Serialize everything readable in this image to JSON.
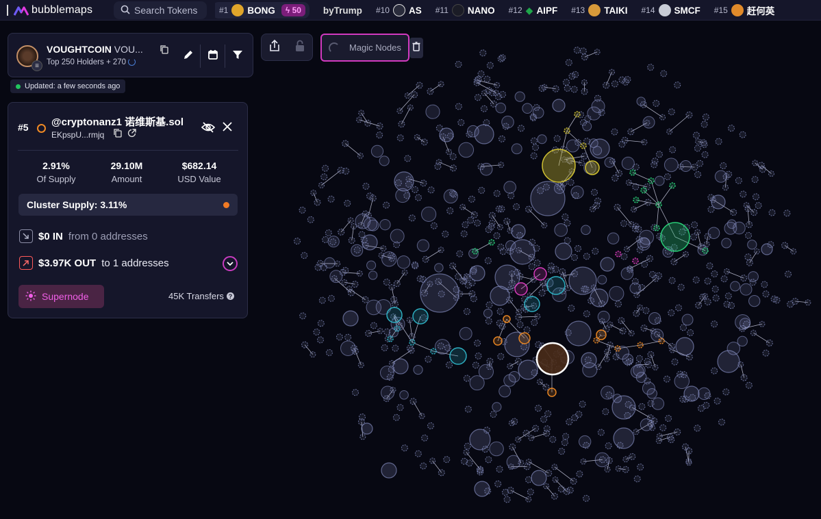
{
  "app": {
    "name": "bubblemaps"
  },
  "search": {
    "placeholder": "Search Tokens"
  },
  "ticker": [
    {
      "rank": "#1",
      "symbol": "BONG",
      "boost": "50",
      "icon": "bong-token-icon",
      "color": "#e0a52a"
    },
    {
      "rank": "",
      "symbol": "byTrump",
      "icon": "",
      "color": ""
    },
    {
      "rank": "#10",
      "symbol": "AS",
      "icon": "as-token-icon",
      "color": "#2a2c3c"
    },
    {
      "rank": "#11",
      "symbol": "NANO",
      "icon": "nano-token-icon",
      "color": "#1b1c26"
    },
    {
      "rank": "#12",
      "symbol": "AIPF",
      "icon": "aipf-token-icon",
      "color": "#1fa64a"
    },
    {
      "rank": "#13",
      "symbol": "TAIKI",
      "icon": "taiki-token-icon",
      "color": "#d89a3a"
    },
    {
      "rank": "#14",
      "symbol": "SMCF",
      "icon": "smcf-token-icon",
      "color": "#c8ccd6"
    },
    {
      "rank": "#15",
      "symbol": "赶何英",
      "icon": "token-15-icon",
      "color": "#e08a2a"
    }
  ],
  "token": {
    "name": "VOUGHTCOIN",
    "name_truncated": "VOU...",
    "holders": "Top 250 Holders + 270",
    "updated": "Updated: a few seconds ago"
  },
  "toolbar": {
    "magic_nodes": "Magic Nodes"
  },
  "wallet": {
    "rank": "#5",
    "name": "@cryptonanz1 诺维斯基.sol",
    "address": "EKpspU...rmjq",
    "stats": [
      {
        "value": "2.91%",
        "label": "Of Supply"
      },
      {
        "value": "29.10M",
        "label": "Amount"
      },
      {
        "value": "$682.14",
        "label": "USD Value"
      }
    ],
    "cluster_supply": "Cluster Supply: 3.11%",
    "in_value": "$0 IN",
    "in_detail": "from 0 addresses",
    "out_value": "$3.97K OUT",
    "out_detail": "to 1 addresses",
    "supernode": "Supernode",
    "transfers": "45K Transfers"
  },
  "colors": {
    "accent_pink": "#d23ac0",
    "bubble_default": "#8a93c7",
    "cluster_yellow": "#d9c934",
    "cluster_green": "#2bd67b",
    "cluster_cyan": "#2fb6c9",
    "cluster_orange": "#f08a24",
    "cluster_magenta": "#e23fc4"
  },
  "bubble_map": {
    "holders_shown": "Top 250 Holders",
    "clusters": [
      "yellow",
      "green",
      "cyan",
      "orange",
      "magenta"
    ]
  }
}
